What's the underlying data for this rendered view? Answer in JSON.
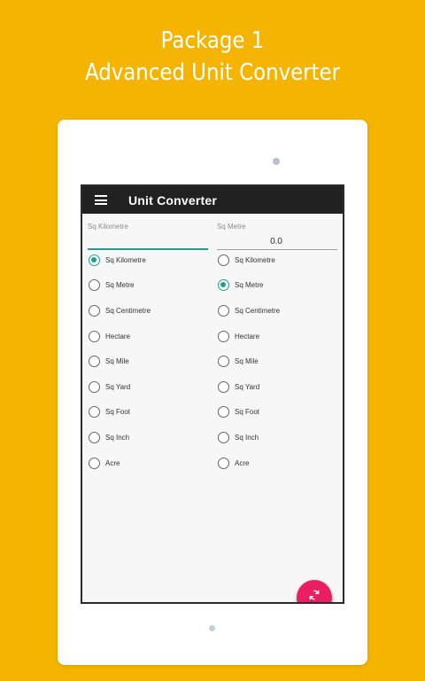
{
  "promo": {
    "line1": "Package 1",
    "line2": "Advanced Unit Converter"
  },
  "app": {
    "title": "Unit Converter",
    "menu_icon": "hamburger-menu-icon",
    "fab_icon": "refresh-icon"
  },
  "from_field": {
    "label": "Sq Kilometre",
    "value": ""
  },
  "to_field": {
    "label": "Sq Metre",
    "value": "0.0"
  },
  "from_units": {
    "items": [
      "Sq Kilometre",
      "Sq Metre",
      "Sq Centimetre",
      "Hectare",
      "Sq Mile",
      "Sq Yard",
      "Sq Foot",
      "Sq Inch",
      "Acre"
    ],
    "selected": "Sq Kilometre"
  },
  "to_units": {
    "items": [
      "Sq Kilometre",
      "Sq Metre",
      "Sq Centimetre",
      "Hectare",
      "Sq Mile",
      "Sq Yard",
      "Sq Foot",
      "Sq Inch",
      "Acre"
    ],
    "selected": "Sq Metre"
  },
  "colors": {
    "background": "#F5B400",
    "accent": "#1f9e8f",
    "fab": "#E91E63",
    "appbar": "#212121"
  }
}
